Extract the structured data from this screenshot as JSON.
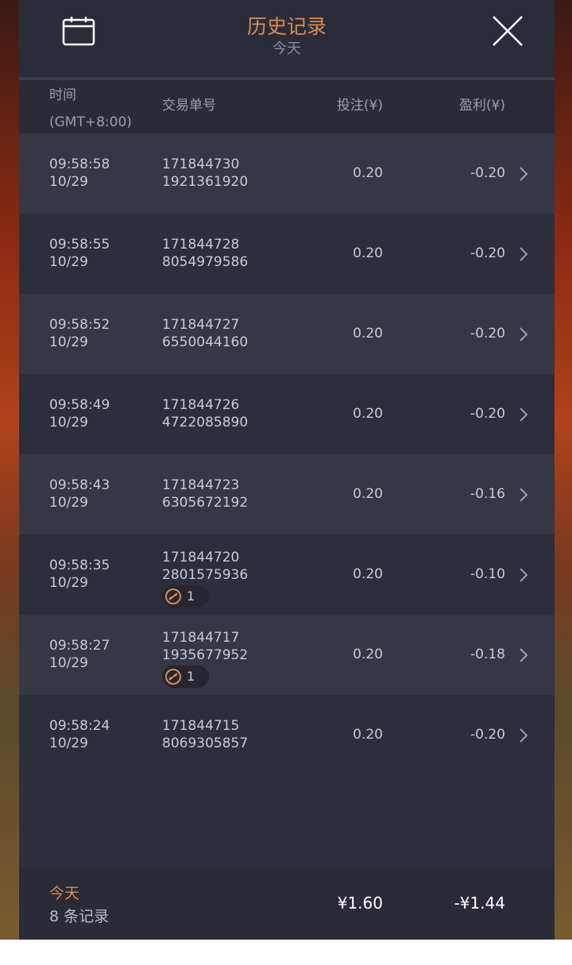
{
  "header": {
    "title": "历史记录",
    "subtitle": "今天"
  },
  "columns": {
    "time_line1": "时间",
    "time_line2": "(GMT+8:00)",
    "order": "交易单号",
    "bet": "投注(¥)",
    "profit": "盈利(¥)"
  },
  "rows": [
    {
      "time": "09:58:58",
      "date": "10/29",
      "order1": "171844730",
      "order2": "1921361920",
      "bet": "0.20",
      "profit": "-0.20",
      "badge": ""
    },
    {
      "time": "09:58:55",
      "date": "10/29",
      "order1": "171844728",
      "order2": "8054979586",
      "bet": "0.20",
      "profit": "-0.20",
      "badge": ""
    },
    {
      "time": "09:58:52",
      "date": "10/29",
      "order1": "171844727",
      "order2": "6550044160",
      "bet": "0.20",
      "profit": "-0.20",
      "badge": ""
    },
    {
      "time": "09:58:49",
      "date": "10/29",
      "order1": "171844726",
      "order2": "4722085890",
      "bet": "0.20",
      "profit": "-0.20",
      "badge": ""
    },
    {
      "time": "09:58:43",
      "date": "10/29",
      "order1": "171844723",
      "order2": "6305672192",
      "bet": "0.20",
      "profit": "-0.16",
      "badge": ""
    },
    {
      "time": "09:58:35",
      "date": "10/29",
      "order1": "171844720",
      "order2": "2801575936",
      "bet": "0.20",
      "profit": "-0.10",
      "badge": "1"
    },
    {
      "time": "09:58:27",
      "date": "10/29",
      "order1": "171844717",
      "order2": "1935677952",
      "bet": "0.20",
      "profit": "-0.18",
      "badge": "1"
    },
    {
      "time": "09:58:24",
      "date": "10/29",
      "order1": "171844715",
      "order2": "8069305857",
      "bet": "0.20",
      "profit": "-0.20",
      "badge": ""
    }
  ],
  "footer": {
    "today": "今天",
    "count": "8 条记录",
    "total_bet": "¥1.60",
    "total_profit": "-¥1.44"
  },
  "colors": {
    "accent": "#d98b52",
    "panel": "#2e2e3c"
  }
}
